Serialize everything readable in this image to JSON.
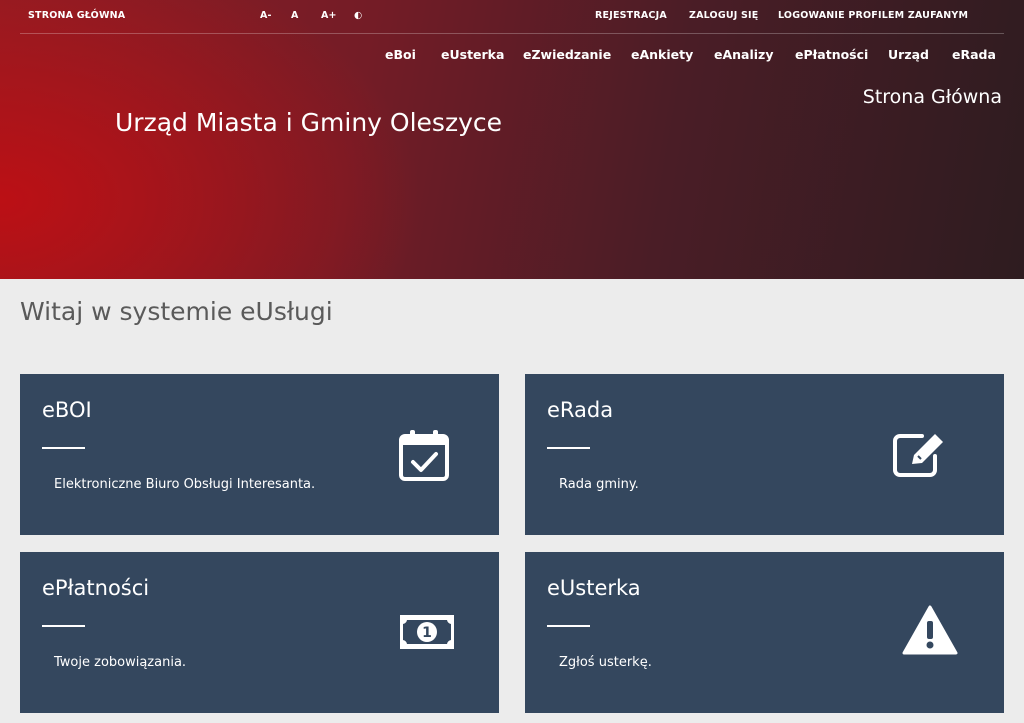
{
  "topbar": {
    "home_link": "STRONA GŁÓWNA",
    "font_controls": [
      "A-",
      "A",
      "A+",
      "◐"
    ],
    "auth_links": [
      "REJESTRACJA",
      "ZALOGUJ SIĘ",
      "LOGOWANIE PROFILEM ZAUFANYM"
    ]
  },
  "nav": {
    "items": [
      "eBoi",
      "eUsterka",
      "eZwiedzanie",
      "eAnkiety",
      "eAnalizy",
      "ePłatności",
      "Urząd",
      "eRada"
    ]
  },
  "header": {
    "breadcrumb": "Strona Główna",
    "site_title": "Urząd Miasta i Gminy Oleszyce"
  },
  "main": {
    "welcome": "Witaj w systemie eUsługi",
    "cards": [
      {
        "title": "eBOI",
        "description": "Elektroniczne Biuro Obsługi Interesanta.",
        "icon": "calendar-check-icon"
      },
      {
        "title": "eRada",
        "description": "Rada gminy.",
        "icon": "edit-icon"
      },
      {
        "title": "ePłatności",
        "description": "Twoje zobowiązania.",
        "icon": "money-bill-icon"
      },
      {
        "title": "eUsterka",
        "description": "Zgłoś usterkę.",
        "icon": "warning-icon"
      }
    ]
  },
  "colors": {
    "card_bg": "#34475e",
    "hero_red": "#b0121a",
    "hero_dark": "#2e1c20",
    "page_bg": "#ececec"
  }
}
